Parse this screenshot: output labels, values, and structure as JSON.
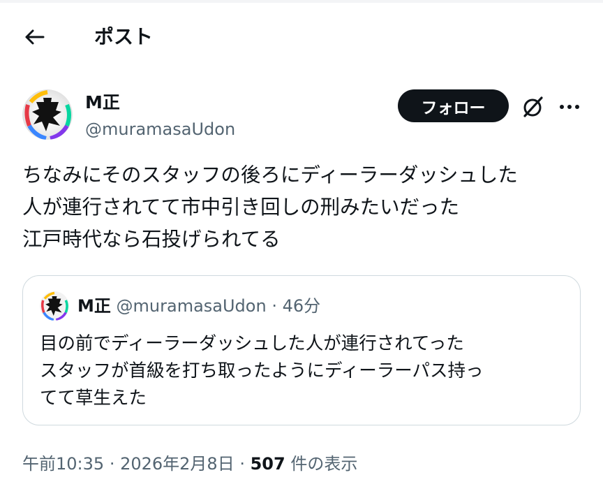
{
  "header": {
    "title": "ポスト",
    "back_icon": "arrow-left-icon"
  },
  "post": {
    "author_name": "M正",
    "author_handle": "@muramasaUdon",
    "follow_label": "フォロー",
    "text_lines": [
      "ちなみにそのスタッフの後ろにディーラーダッシュした",
      "人が連行されてて市中引き回しの刑みたいだった",
      "江戸時代なら石投げられてる"
    ],
    "timestamp": "午前10:35",
    "date": "2026年2月8日",
    "views_count": "507",
    "views_label": "件の表示"
  },
  "quote": {
    "author_name": "M正",
    "author_handle": "@muramasaUdon",
    "separator": "·",
    "time": "46分",
    "text_lines": [
      "目の前でディーラーダッシュした人が連行されてった",
      "スタッフが首級を打ち取ったようにディーラーパス持っ",
      "てて草生えた"
    ]
  },
  "colors": {
    "text_primary": "#0f1419",
    "text_secondary": "#536471",
    "border": "#cfd9de",
    "button_bg": "#0f1419"
  },
  "icons": {
    "grok": "grok-slash-icon",
    "more": "more-horizontal-icon"
  }
}
